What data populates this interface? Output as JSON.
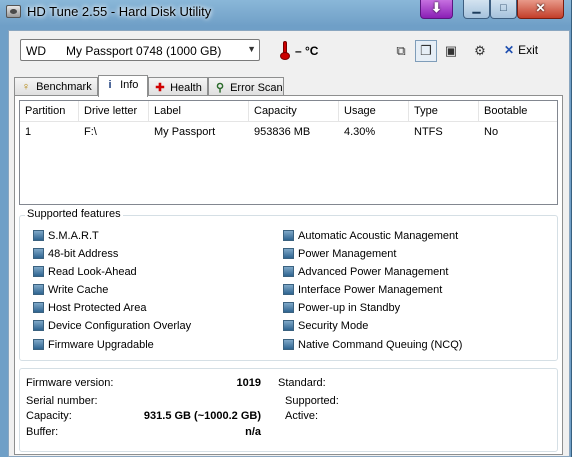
{
  "window": {
    "title": "HD Tune 2.55 - Hard Disk Utility",
    "min_glyph": "▁",
    "max_glyph": "□",
    "close_glyph": "✕",
    "download_glyph": "⬇"
  },
  "toolbar": {
    "drive": "WD      My Passport 0748 (1000 GB)",
    "temperature": "– °C",
    "exit_label": "Exit"
  },
  "tabs": [
    {
      "label": "Benchmark",
      "icon": "benchmark-icon"
    },
    {
      "label": "Info",
      "icon": "info-icon"
    },
    {
      "label": "Health",
      "icon": "health-cross-icon"
    },
    {
      "label": "Error Scan",
      "icon": "magnifier-icon"
    }
  ],
  "partitions": {
    "columns": [
      "Partition",
      "Drive letter",
      "Label",
      "Capacity",
      "Usage",
      "Type",
      "Bootable"
    ],
    "rows": [
      [
        "1",
        "F:\\",
        "My Passport",
        "953836 MB",
        "4.30%",
        "NTFS",
        "No"
      ]
    ]
  },
  "features": {
    "legend": "Supported features",
    "left": [
      "S.M.A.R.T",
      "48-bit Address",
      "Read Look-Ahead",
      "Write Cache",
      "Host Protected Area",
      "Device Configuration Overlay",
      "Firmware Upgradable"
    ],
    "right": [
      "Automatic Acoustic Management",
      "Power Management",
      "Advanced Power Management",
      "Interface Power Management",
      "Power-up in Standby",
      "Security Mode",
      "Native Command Queuing (NCQ)"
    ]
  },
  "details": {
    "firmware_label": "Firmware version:",
    "firmware_value": "1019",
    "serial_label": "Serial number:",
    "serial_value": "",
    "capacity_label": "Capacity:",
    "capacity_value": "931.5 GB (~1000.2 GB)",
    "buffer_label": "Buffer:",
    "buffer_value": "n/a",
    "standard_label": "Standard:",
    "supported_label": "Supported:",
    "active_label": "Active:"
  }
}
